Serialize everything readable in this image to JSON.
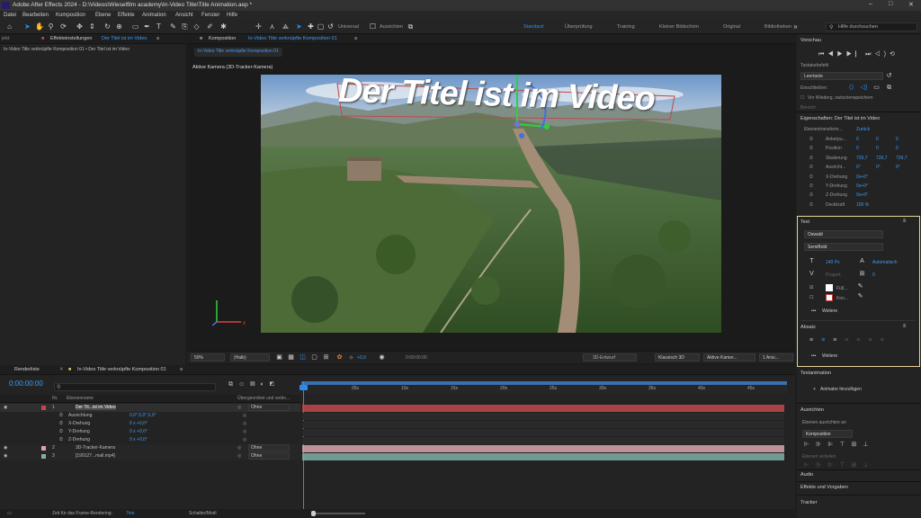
{
  "app": {
    "title": "Adobe After Effects 2024 - D:\\Videos\\Wieselfilm academy\\In-Video Title\\Title Animation.aep *"
  },
  "menu": [
    "Datei",
    "Bearbeiten",
    "Komposition",
    "Ebene",
    "Effekte",
    "Animation",
    "Ansicht",
    "Fenster",
    "Hilfe"
  ],
  "toolbar": {
    "universal_label": "Universal",
    "align_label": "Ausrichten",
    "workspaces": [
      "Standard",
      "Überprüfung",
      "Training",
      "Kleiner Bildschirm",
      "Original",
      "Bibliotheken"
    ],
    "active_workspace": "Standard",
    "help_placeholder": "Hilfe durchsuchen"
  },
  "effects_panel": {
    "tab_label": "Effekteinstellungen",
    "tab_layer": "Der Titel ist im Video",
    "breadcrumb": "In-Video Title verknüpfte Komposition 01 • Der Titel ist im Video",
    "left_stub": "jekt"
  },
  "viewer": {
    "tab_label": "Komposition",
    "tab_comp": "In-Video Title verknüpfte Komposition 01",
    "comp_chip": "In-Video Title verknüpfte Komposition 01",
    "camera_label": "Aktive Kamera (3D-Tracker-Kamera)",
    "title_text": "Der Titel ist im Video",
    "zoom": "50%",
    "resolution": "(Halb)",
    "exposure": "+0,0",
    "timecode": "0:00:00:00",
    "draft3d": "3D-Entwurf",
    "renderer": "Klassisch 3D",
    "view": "Aktive Kamer...",
    "views_count": "1 Ansi..."
  },
  "right_panel": {
    "preview_title": "Vorschau",
    "shortcut_label": "Tastaturbefehl",
    "shortcut_value": "Leertaste",
    "include_label": "Einschließen:",
    "loop_label": "Vor Wiederg. zwischenspeichern",
    "range_label": "Bereich",
    "props_title": "Eigenschaften: Der Titel ist im Video",
    "layer_transform": "Ebenentransform...",
    "reset": "Zurück",
    "props": [
      {
        "name": "Ankerpu...",
        "v1": "0",
        "v2": "0",
        "v3": "0"
      },
      {
        "name": "Position",
        "v1": "0",
        "v2": "0",
        "v3": "0"
      },
      {
        "name": "Skalierung",
        "v1": "729,7",
        "v2": "729,7",
        "v3": "729,7"
      },
      {
        "name": "Ausricht...",
        "v1": "0°",
        "v2": "0°",
        "v3": "0°"
      },
      {
        "name": "X-Drehung",
        "v1": "0x+0°",
        "v2": "",
        "v3": ""
      },
      {
        "name": "Y-Drehung",
        "v1": "0x+0°",
        "v2": "",
        "v3": ""
      },
      {
        "name": "Z-Drehung",
        "v1": "0x+0°",
        "v2": "",
        "v3": ""
      },
      {
        "name": "Deckkraft",
        "v1": "100 %",
        "v2": "",
        "v3": ""
      }
    ],
    "text_title": "Text",
    "font": "Oswald",
    "font_style": "SemiBold",
    "font_size": "140 Px",
    "leading": "Automatisch",
    "kerning": "Proport.",
    "tracking": "0",
    "fill_label": "Füll...",
    "stroke_label": "Kon...",
    "more1": "Weitere",
    "paragraph_title": "Absatz",
    "more2": "Weitere",
    "text_anim_title": "Textanimation",
    "add_animator": "Animator hinzufügen",
    "align_title": "Ausrichten",
    "align_to_label": "Ebenen ausrichten an",
    "align_to_value": "Komposition",
    "distribute_label": "Ebenen verteilen",
    "audio_title": "Audio",
    "effects_title": "Effekte und Vorgaben",
    "tracker_title": "Tracker",
    "text_accent": "#e6d59a"
  },
  "timeline": {
    "tab1": "Renderliste",
    "tab2": "In-Video Title verknüpfte Komposition 01",
    "timecode": "0:00:00:00",
    "col_name": "Ebenenname",
    "col_parent": "Übergeordnet und verkn...",
    "col_nr": "Nr.",
    "ticks": [
      "0s",
      "05s",
      "10s",
      "15s",
      "20s",
      "25s",
      "30s",
      "35s",
      "40s",
      "45s"
    ],
    "layers": [
      {
        "nr": "1",
        "name": "Der Tit...ist im Video",
        "parent": "Ohne",
        "color": "#c2464a",
        "type": "T"
      },
      {
        "nr": "",
        "name": "Ausrichtung",
        "value": "0,0°,0,0°,0,0°",
        "sub": true
      },
      {
        "nr": "",
        "name": "X-Drehung",
        "value": "0 x +0,0°",
        "sub": true
      },
      {
        "nr": "",
        "name": "Y-Drehung",
        "value": "0 x +0,0°",
        "sub": true
      },
      {
        "nr": "",
        "name": "Z-Drehung",
        "value": "0 x +0,0°",
        "sub": true
      },
      {
        "nr": "2",
        "name": "3D-Tracker-Kamera",
        "parent": "Ohne",
        "color": "#d9a3ad",
        "type": "cam"
      },
      {
        "nr": "3",
        "name": "[199127...mall.mp4]",
        "parent": "Ohne",
        "color": "#7fb0a6",
        "type": "vid"
      }
    ]
  },
  "status": {
    "render_label": "Zeit für das Frame-Rendering:",
    "render_value": "7ms",
    "mode": "Schalter/Modi"
  }
}
